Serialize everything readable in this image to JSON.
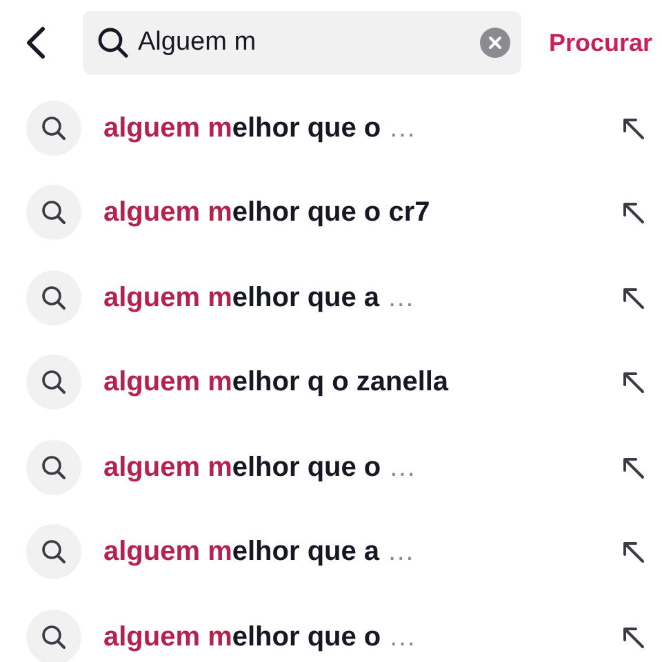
{
  "search": {
    "value": "Alguem m",
    "submit": "Procurar"
  },
  "suggestions": [
    {
      "match": "alguem m",
      "rest": "elhor que o",
      "ellipsis": "…"
    },
    {
      "match": "alguem m",
      "rest": "elhor que o cr7"
    },
    {
      "match": "alguem m",
      "rest": "elhor que a",
      "ellipsis": "…"
    },
    {
      "match": "alguem m",
      "rest": "elhor q o zanella"
    },
    {
      "match": "alguem m",
      "rest": "elhor que o",
      "ellipsis": "…"
    },
    {
      "match": "alguem m",
      "rest": "elhor que a",
      "ellipsis": "…"
    },
    {
      "match": "alguem m",
      "rest": "elhor que o",
      "ellipsis": "…"
    }
  ]
}
